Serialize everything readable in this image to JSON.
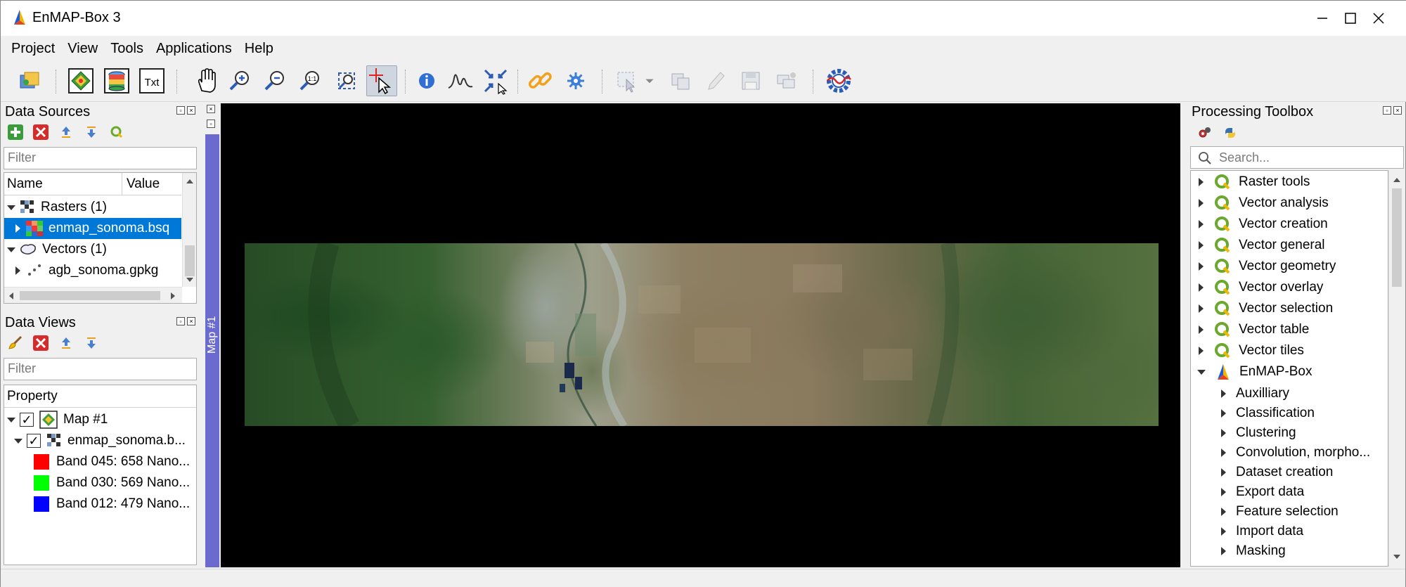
{
  "window": {
    "title": "EnMAP-Box 3"
  },
  "menu": [
    "Project",
    "View",
    "Tools",
    "Applications",
    "Help"
  ],
  "toolbar": {
    "txt_label": "Txt",
    "icons": [
      "open-project-icon",
      "add-raster-icon",
      "add-database-icon",
      "add-text-icon",
      "pan-icon",
      "zoom-in-icon",
      "zoom-out-icon",
      "zoom-native-icon",
      "zoom-full-icon",
      "identify-cursor-icon",
      "info-icon",
      "spectral-profile-icon",
      "crosshair-icon",
      "link-icon",
      "settings-icon",
      "select-icon",
      "dropdown-icon",
      "copy-icon",
      "edit-icon",
      "save-icon",
      "layers-icon",
      "enmap-app-icon"
    ]
  },
  "data_sources": {
    "title": "Data Sources",
    "filter_placeholder": "Filter",
    "columns": [
      "Name",
      "Value"
    ],
    "groups": [
      {
        "label": "Rasters (1)",
        "items": [
          "enmap_sonoma.bsq"
        ]
      },
      {
        "label": "Vectors (1)",
        "items": [
          "agb_sonoma.gpkg"
        ]
      }
    ]
  },
  "data_views": {
    "title": "Data Views",
    "filter_placeholder": "Filter",
    "column": "Property",
    "map": "Map #1",
    "layer": "enmap_sonoma.b...",
    "bands": [
      {
        "label": "Band 045: 658 Nano...",
        "color": "#ff0000"
      },
      {
        "label": "Band 030: 569 Nano...",
        "color": "#00ff00"
      },
      {
        "label": "Band 012: 479 Nano...",
        "color": "#0000ff"
      }
    ]
  },
  "map": {
    "dock_label": "Map #1"
  },
  "processing_toolbox": {
    "title": "Processing Toolbox",
    "search_placeholder": "Search...",
    "top_items": [
      "Raster tools",
      "Vector analysis",
      "Vector creation",
      "Vector general",
      "Vector geometry",
      "Vector overlay",
      "Vector selection",
      "Vector table",
      "Vector tiles"
    ],
    "enmap_group": "EnMAP-Box",
    "enmap_children": [
      "Auxilliary",
      "Classification",
      "Clustering",
      "Convolution, morpho...",
      "Dataset creation",
      "Export data",
      "Feature selection",
      "Import data",
      "Masking"
    ]
  }
}
